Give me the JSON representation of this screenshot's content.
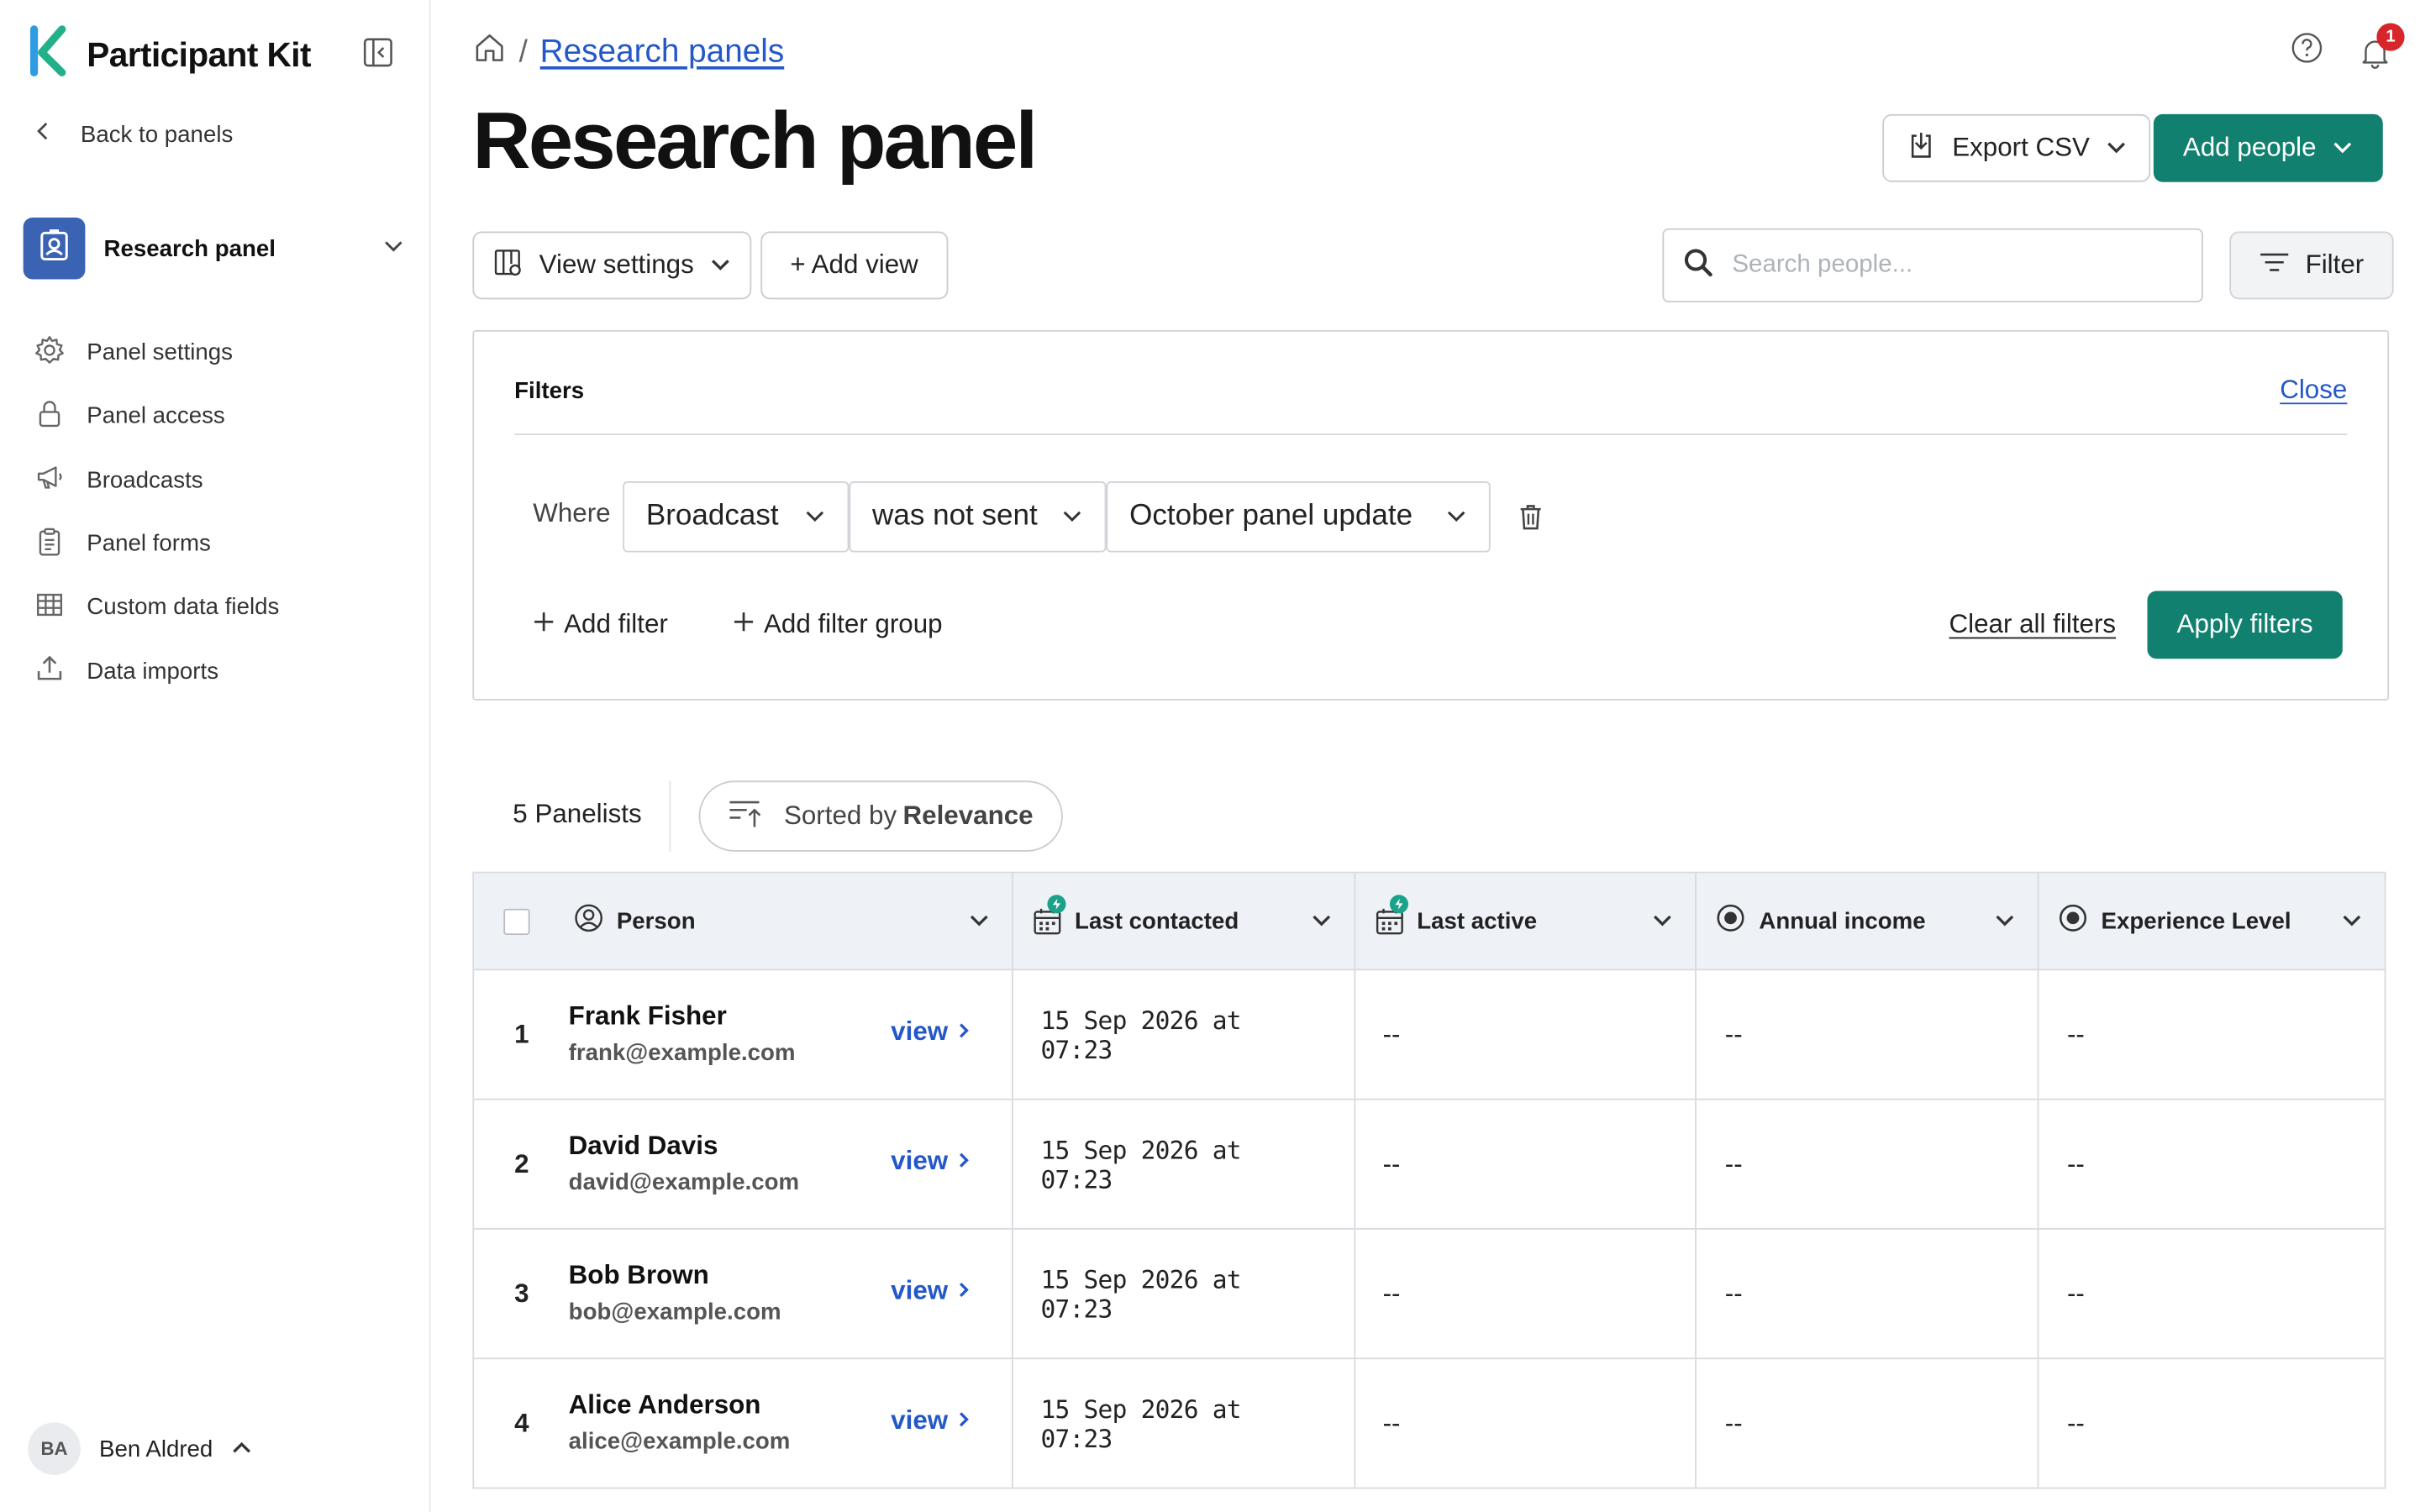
{
  "app": {
    "name": "Participant Kit"
  },
  "sidebar": {
    "back_label": "Back to panels",
    "panel_name": "Research panel",
    "items": [
      {
        "label": "Panel settings",
        "icon": "gear-icon"
      },
      {
        "label": "Panel access",
        "icon": "lock-icon"
      },
      {
        "label": "Broadcasts",
        "icon": "megaphone-icon"
      },
      {
        "label": "Panel forms",
        "icon": "clipboard-icon"
      },
      {
        "label": "Custom data fields",
        "icon": "table-icon"
      },
      {
        "label": "Data imports",
        "icon": "upload-icon"
      }
    ],
    "user": {
      "initials": "BA",
      "name": "Ben Aldred"
    }
  },
  "header": {
    "breadcrumb_link": "Research panels",
    "breadcrumb_sep": "/",
    "title": "Research panel",
    "notifications_count": "1",
    "export_label": "Export CSV",
    "add_people_label": "Add people"
  },
  "toolbar": {
    "view_settings_label": "View settings",
    "add_view_label": "+ Add view",
    "search_placeholder": "Search people...",
    "filter_label": "Filter"
  },
  "filters": {
    "title": "Filters",
    "close_label": "Close",
    "where_label": "Where",
    "field": "Broadcast",
    "operator": "was not sent",
    "value": "October panel update",
    "add_filter": "Add filter",
    "add_group": "Add filter group",
    "clear_all": "Clear all filters",
    "apply": "Apply filters"
  },
  "list": {
    "count_label": "5 Panelists",
    "sort_prefix": "Sorted by",
    "sort_value": "Relevance"
  },
  "table": {
    "columns": [
      "Person",
      "Last contacted",
      "Last active",
      "Annual income",
      "Experience Level"
    ],
    "view_label": "view",
    "rows": [
      {
        "index": "1",
        "name": "Frank Fisher",
        "email": "frank@example.com",
        "last_contacted": "15 Sep 2026 at 07:23",
        "last_active": "--",
        "annual_income": "--",
        "experience_level": "--"
      },
      {
        "index": "2",
        "name": "David Davis",
        "email": "david@example.com",
        "last_contacted": "15 Sep 2026 at 07:23",
        "last_active": "--",
        "annual_income": "--",
        "experience_level": "--"
      },
      {
        "index": "3",
        "name": "Bob Brown",
        "email": "bob@example.com",
        "last_contacted": "15 Sep 2026 at 07:23",
        "last_active": "--",
        "annual_income": "--",
        "experience_level": "--"
      },
      {
        "index": "4",
        "name": "Alice Anderson",
        "email": "alice@example.com",
        "last_contacted": "15 Sep 2026 at 07:23",
        "last_active": "--",
        "annual_income": "--",
        "experience_level": "--"
      }
    ]
  },
  "colors": {
    "primary": "#11806f",
    "link": "#2458c9",
    "panel_badge": "#3b63b3",
    "alert": "#d7262b"
  }
}
